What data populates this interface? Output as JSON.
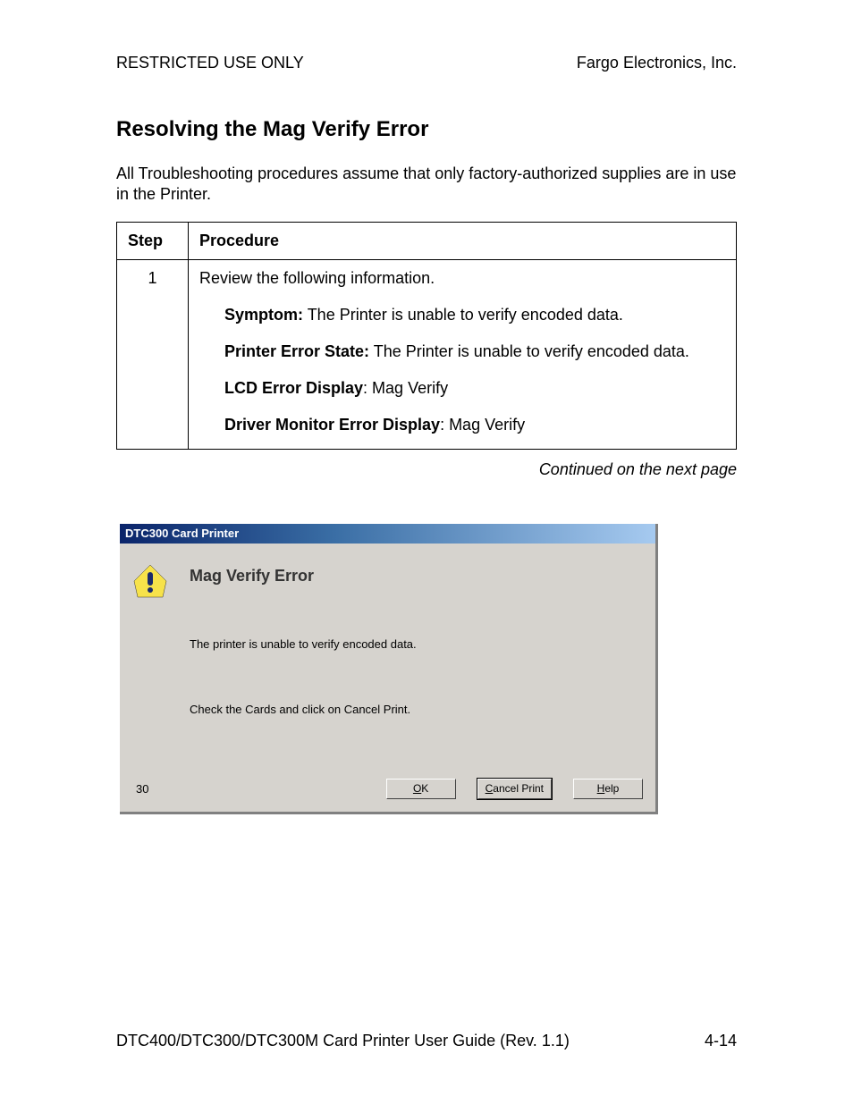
{
  "header": {
    "left": "RESTRICTED USE ONLY",
    "right": "Fargo Electronics, Inc."
  },
  "title": "Resolving the Mag Verify Error",
  "intro": "All Troubleshooting procedures assume that only factory-authorized supplies are in use in the Printer.",
  "table": {
    "col1": "Step",
    "col2": "Procedure",
    "step_num": "1",
    "review": "Review the following information.",
    "symptom_label": "Symptom:",
    "symptom_text": "  The Printer is unable to verify encoded data.",
    "pes_label": "Printer Error State:",
    "pes_text": "  The Printer is unable to verify encoded data.",
    "lcd_label": "LCD Error Display",
    "lcd_text": ":  Mag Verify",
    "dmed_label": "Driver Monitor Error Display",
    "dmed_text": ":  Mag Verify"
  },
  "continued": "Continued on the next page",
  "dialog": {
    "title": "DTC300 Card Printer",
    "heading": "Mag Verify Error",
    "msg1": "The printer is unable to verify encoded data.",
    "msg2": "Check the Cards and click on Cancel Print.",
    "counter": "30",
    "ok_u": "O",
    "ok_r": "K",
    "cancel_u": "C",
    "cancel_r": "ancel Print",
    "help_u": "H",
    "help_r": "elp"
  },
  "footer": {
    "left": "DTC400/DTC300/DTC300M Card Printer User Guide (Rev. 1.1)",
    "right": "4-14"
  }
}
